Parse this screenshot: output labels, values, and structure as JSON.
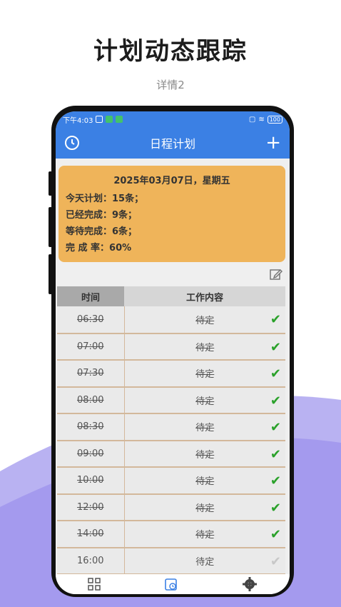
{
  "promo": {
    "title": "计划动态跟踪",
    "subtitle": "详情2"
  },
  "status_bar": {
    "time": "下午4:03",
    "battery": "100"
  },
  "app_bar": {
    "title": "日程计划"
  },
  "summary": {
    "date": "2025年03月07日，星期五",
    "lines": [
      "今天计划：15条；",
      "已经完成：9条；",
      "等待完成：6条；",
      "完 成 率：60%"
    ]
  },
  "table": {
    "headers": [
      "时间",
      "工作内容"
    ],
    "rows": [
      {
        "time": "06:30",
        "content": "待定",
        "done": true
      },
      {
        "time": "07:00",
        "content": "待定",
        "done": true
      },
      {
        "time": "07:30",
        "content": "待定",
        "done": true
      },
      {
        "time": "08:00",
        "content": "待定",
        "done": true
      },
      {
        "time": "08:30",
        "content": "待定",
        "done": true
      },
      {
        "time": "09:00",
        "content": "待定",
        "done": true
      },
      {
        "time": "10:00",
        "content": "待定",
        "done": true
      },
      {
        "time": "12:00",
        "content": "待定",
        "done": true
      },
      {
        "time": "14:00",
        "content": "待定",
        "done": true
      },
      {
        "time": "16:00",
        "content": "待定",
        "done": false
      }
    ]
  },
  "tabs": [
    {
      "icon": "grid-icon"
    },
    {
      "icon": "calendar-clock-icon"
    },
    {
      "icon": "gear-icon"
    }
  ],
  "colors": {
    "accent": "#3b80e4",
    "summary_bg": "#efb45a",
    "check": "#2aa12a"
  }
}
